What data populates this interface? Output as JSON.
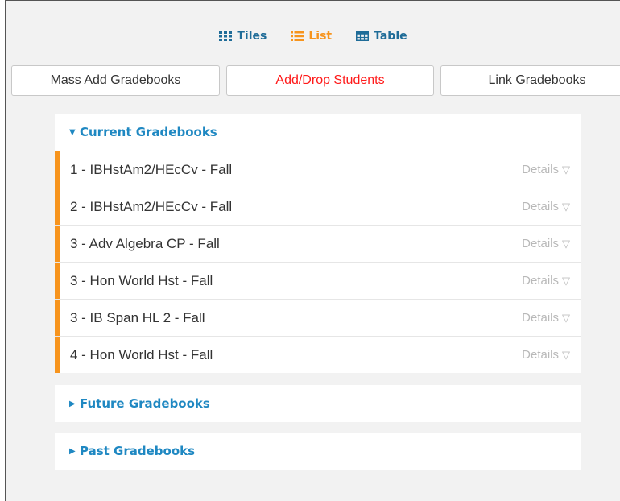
{
  "view_switch": {
    "tiles_label": "Tiles",
    "list_label": "List",
    "table_label": "Table",
    "active": "List"
  },
  "actions": {
    "mass_add_label": "Mass Add Gradebooks",
    "add_drop_label": "Add/Drop Students",
    "link_label": "Link Gradebooks"
  },
  "current": {
    "title": "Current Gradebooks",
    "details_label": "Details",
    "rows": [
      "1 - IBHstAm2/HEcCv - Fall",
      "2 - IBHstAm2/HEcCv - Fall",
      "3 - Adv Algebra CP - Fall",
      "3 - Hon World Hst - Fall",
      "3 - IB Span HL 2 - Fall",
      "4 - Hon World Hst - Fall"
    ]
  },
  "future": {
    "title": "Future Gradebooks"
  },
  "past": {
    "title": "Past Gradebooks"
  },
  "colors": {
    "accent_orange": "#f7941d",
    "link_blue": "#1f88c2",
    "nav_blue": "#1f6c98",
    "alert_red": "#ff1a1a"
  }
}
